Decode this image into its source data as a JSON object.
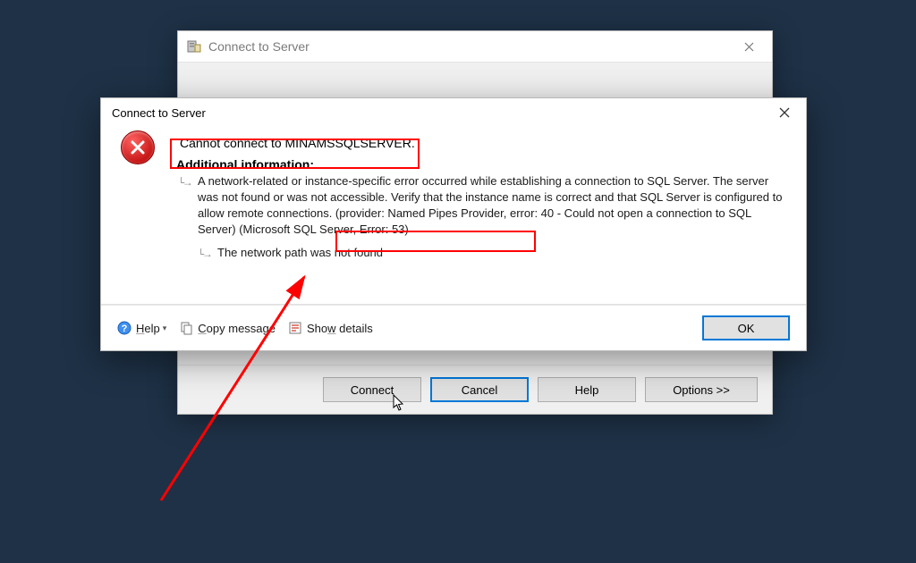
{
  "bgWindow": {
    "title": "Connect to Server",
    "buttons": {
      "connect": "Connect",
      "cancel": "Cancel",
      "help": "Help",
      "options": "Options >>"
    }
  },
  "dialog": {
    "title": "Connect to Server",
    "headline": "Cannot connect to MINAMSSQLSERVER.",
    "additional_header": "Additional information:",
    "info_main": "A network-related or instance-specific error occurred while establishing a connection to SQL Server. The server was not found or was not accessible. Verify that the instance name is correct and that SQL Server is configured to allow remote connections. (provider: Named Pipes Provider, error: 40 - Could not open a connection to SQL Server) (Microsoft SQL Server, Error: 53)",
    "info_sub": "The network path was not found",
    "footer": {
      "help": "Help",
      "copy": "Copy message",
      "show": "Show details",
      "ok": "OK"
    }
  }
}
